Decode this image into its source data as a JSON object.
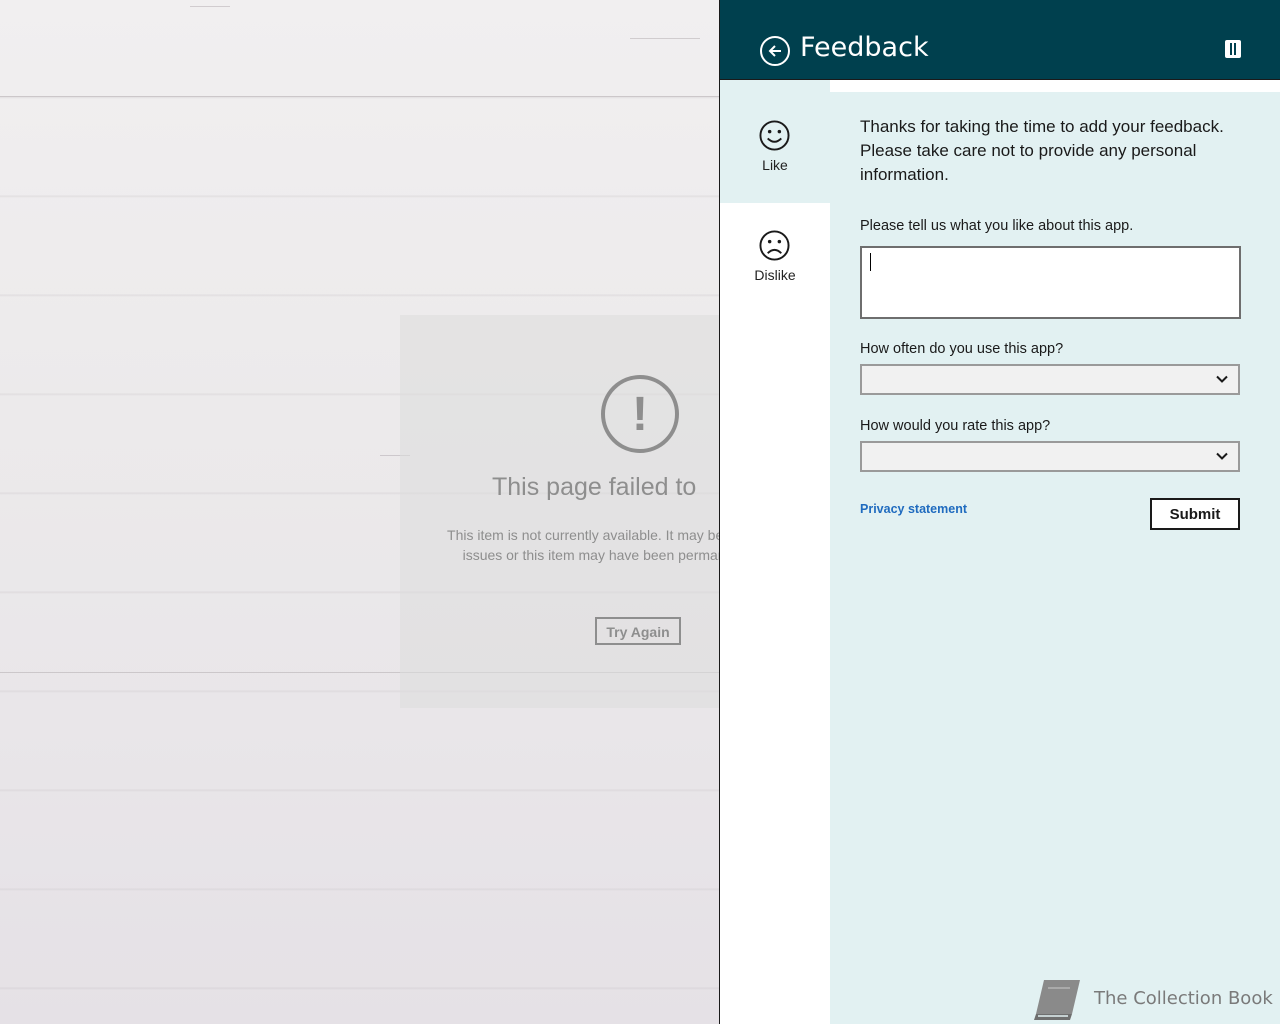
{
  "background_app": {
    "error_title": "This page failed to",
    "error_message": "This item is not currently available. It may be due to temporary issues or this item may have been permanently removed.",
    "try_again_label": "Try Again"
  },
  "flyout": {
    "title": "Feedback",
    "tabs": [
      {
        "label": "Like",
        "icon": "smiley-icon",
        "selected": true
      },
      {
        "label": "Dislike",
        "icon": "frown-icon",
        "selected": false
      }
    ],
    "intro": "Thanks for taking the time to add your feedback. Please take care not to provide any personal information.",
    "comment_label": "Please tell us what you like about this app.",
    "comment_value": "",
    "frequency_label": "How often do you use this app?",
    "frequency_value": "",
    "rating_label": "How would you rate this app?",
    "rating_value": "",
    "privacy_label": "Privacy statement",
    "submit_label": "Submit",
    "brand_name": "The Collection Book"
  },
  "colors": {
    "header": "#00404e",
    "panel": "#e2f1f2",
    "link": "#1f6bbf"
  }
}
